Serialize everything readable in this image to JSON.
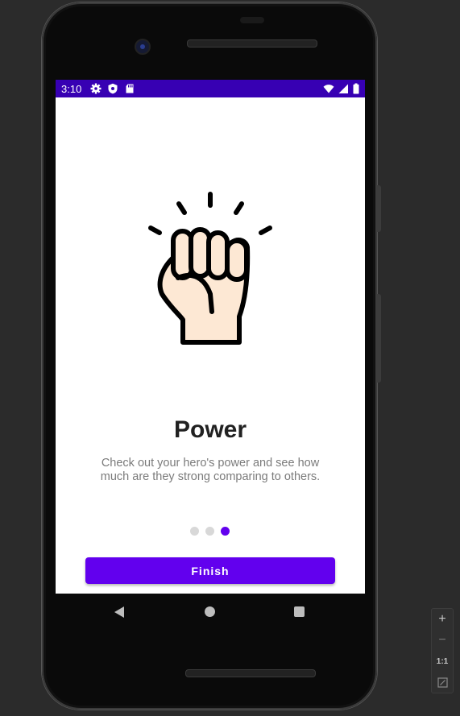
{
  "status_bar": {
    "time": "3:10",
    "left_icons": [
      "gear-icon",
      "shield-icon",
      "sd-card-icon"
    ],
    "right_icons": [
      "wifi-icon",
      "signal-icon",
      "battery-icon"
    ],
    "background": "#3700b3"
  },
  "onboarding": {
    "illustration": "raised-fist-icon",
    "title": "Power",
    "description": "Check out your hero's power and see how much are they strong comparing to others.",
    "page_count": 3,
    "current_page": 3,
    "finish_label": "Finish",
    "accent": "#6200ee"
  },
  "nav_bar": {
    "buttons": [
      "back-icon",
      "home-icon",
      "recents-icon"
    ]
  },
  "zoom_controls": {
    "zoom_in": "+",
    "zoom_out": "−",
    "actual_size": "1:1",
    "fit_icon": "fit-screen-icon"
  }
}
